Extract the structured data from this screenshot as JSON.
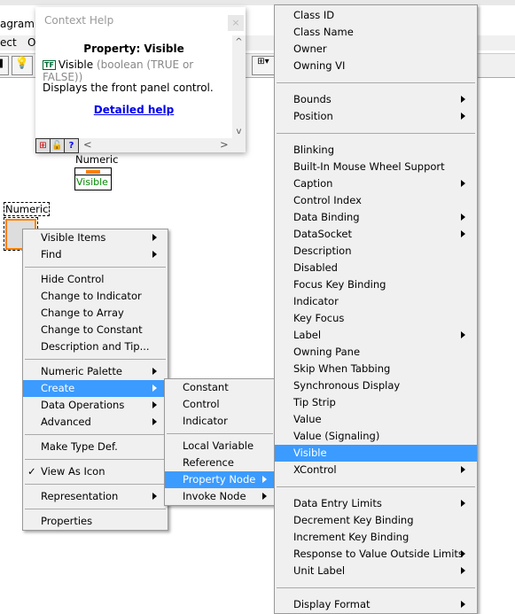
{
  "window": {
    "title": "agram *",
    "menu": [
      "ect",
      "O"
    ]
  },
  "context_help": {
    "title": "Context Help",
    "close": "×",
    "property_heading": "Property:  Visible",
    "type_badge": "TF",
    "property_name": "Visible",
    "property_type": " (boolean (TRUE or FALSE))",
    "description": "Displays the front panel control.",
    "link": "Detailed help",
    "scroll_up": "^",
    "scroll_down": "v",
    "scroll_left": "<",
    "scroll_right": ">"
  },
  "diagram": {
    "property_node_label": "Numeric",
    "property_node_item": "Visible",
    "control_label": "Numeric"
  },
  "context_menu": [
    {
      "label": "Visible Items",
      "arrow": true
    },
    {
      "label": "Find",
      "arrow": true
    },
    {
      "sep": true
    },
    {
      "label": "Hide Control"
    },
    {
      "label": "Change to Indicator"
    },
    {
      "label": "Change to Array"
    },
    {
      "label": "Change to Constant"
    },
    {
      "label": "Description and Tip..."
    },
    {
      "sep": true
    },
    {
      "label": "Numeric Palette",
      "arrow": true
    },
    {
      "label": "Create",
      "arrow": true,
      "highlight": true
    },
    {
      "label": "Data Operations",
      "arrow": true
    },
    {
      "label": "Advanced",
      "arrow": true
    },
    {
      "sep": true
    },
    {
      "label": "Make Type Def."
    },
    {
      "sep": true
    },
    {
      "label": "View As Icon",
      "check": "✓"
    },
    {
      "sep": true
    },
    {
      "label": "Representation",
      "arrow": true
    },
    {
      "sep": true
    },
    {
      "label": "Properties"
    }
  ],
  "create_submenu": [
    {
      "label": "Constant"
    },
    {
      "label": "Control"
    },
    {
      "label": "Indicator"
    },
    {
      "sep": true
    },
    {
      "label": "Local Variable"
    },
    {
      "label": "Reference"
    },
    {
      "label": "Property Node",
      "arrow": true,
      "highlight": true
    },
    {
      "label": "Invoke Node",
      "arrow": true
    }
  ],
  "property_submenu": [
    {
      "label": "Class ID"
    },
    {
      "label": "Class Name"
    },
    {
      "label": "Owner"
    },
    {
      "label": "Owning VI"
    },
    {
      "sep": true
    },
    {
      "label": "Bounds",
      "arrow": true
    },
    {
      "label": "Position",
      "arrow": true
    },
    {
      "sep": true
    },
    {
      "label": "Blinking"
    },
    {
      "label": "Built-In Mouse Wheel Support"
    },
    {
      "label": "Caption",
      "arrow": true
    },
    {
      "label": "Control Index"
    },
    {
      "label": "Data Binding",
      "arrow": true
    },
    {
      "label": "DataSocket",
      "arrow": true
    },
    {
      "label": "Description"
    },
    {
      "label": "Disabled"
    },
    {
      "label": "Focus Key Binding"
    },
    {
      "label": "Indicator"
    },
    {
      "label": "Key Focus"
    },
    {
      "label": "Label",
      "arrow": true
    },
    {
      "label": "Owning Pane"
    },
    {
      "label": "Skip When Tabbing"
    },
    {
      "label": "Synchronous Display"
    },
    {
      "label": "Tip Strip"
    },
    {
      "label": "Value"
    },
    {
      "label": "Value (Signaling)"
    },
    {
      "label": "Visible",
      "highlight": true
    },
    {
      "label": "XControl",
      "arrow": true
    },
    {
      "sep": true
    },
    {
      "label": "Data Entry Limits",
      "arrow": true
    },
    {
      "label": "Decrement Key Binding"
    },
    {
      "label": "Increment Key Binding"
    },
    {
      "label": "Response to Value Outside Limits",
      "arrow": true
    },
    {
      "label": "Unit Label",
      "arrow": true
    },
    {
      "sep": true
    },
    {
      "label": "Display Format",
      "arrow": true
    }
  ],
  "colors": {
    "highlight": "#3c9bff",
    "selection_orange": "#ff8000",
    "link": "#0000ee"
  }
}
